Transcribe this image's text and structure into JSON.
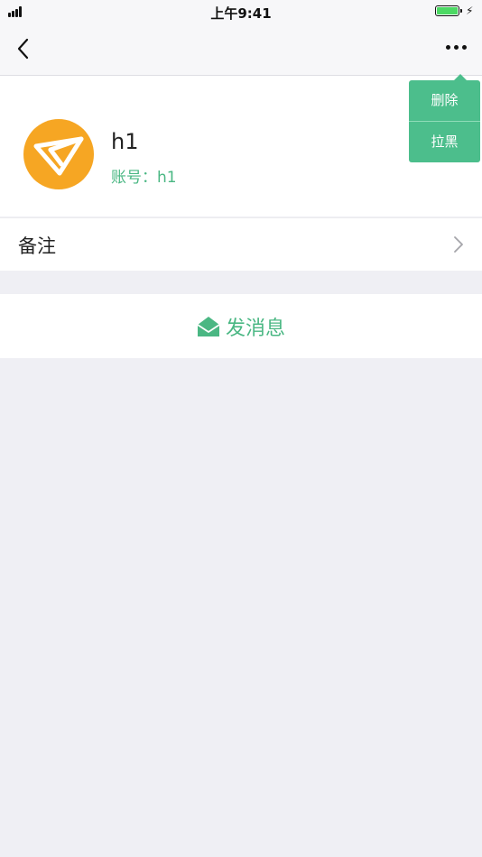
{
  "status_bar": {
    "time": "上午9:41",
    "charge_symbol": "⚡"
  },
  "nav": {
    "back_icon": "chevron-left-icon",
    "more_icon": "more-dots-icon"
  },
  "profile": {
    "name": "h1",
    "account": "账号：h1",
    "avatar_icon": "paper-plane-icon"
  },
  "remark": {
    "label": "备注"
  },
  "send": {
    "label": "发消息",
    "icon": "envelope-open-icon"
  },
  "popup_menu": {
    "items": [
      {
        "label": "删除"
      },
      {
        "label": "拉黑"
      }
    ]
  },
  "colors": {
    "accent_green": "#4ab783",
    "menu_green": "#4cbe8c",
    "avatar_orange": "#f6a623",
    "background": "#efeff4"
  }
}
